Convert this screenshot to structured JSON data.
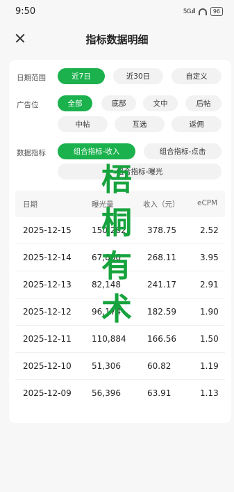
{
  "status_bar": {
    "time": "9:50",
    "signal": "5G.ıll",
    "battery": "96"
  },
  "header": {
    "title": "指标数据明细"
  },
  "filters": {
    "date": {
      "label": "日期范围",
      "options": [
        "近7日",
        "近30日",
        "自定义"
      ],
      "selected": "近7日"
    },
    "ad_slot": {
      "label": "广告位",
      "options": [
        "全部",
        "底部",
        "文中",
        "后帖",
        "中帖",
        "互选",
        "返佣"
      ],
      "selected": "全部"
    },
    "metric": {
      "label": "数据指标",
      "options": [
        "组合指标-收入",
        "组合指标-点击",
        "组合指标-曝光"
      ],
      "selected": "组合指标-收入"
    }
  },
  "table": {
    "headers": [
      "日期",
      "曝光量",
      "收入（元）",
      "eCPM"
    ],
    "rows": [
      [
        "2025-12-15",
        "150,262",
        "378.75",
        "2.52"
      ],
      [
        "2025-12-14",
        "67,806",
        "268.11",
        "3.95"
      ],
      [
        "2025-12-13",
        "82,148",
        "241.17",
        "2.91"
      ],
      [
        "2025-12-12",
        "96,174",
        "182.59",
        "1.90"
      ],
      [
        "2025-12-11",
        "110,884",
        "166.56",
        "1.50"
      ],
      [
        "2025-12-10",
        "51,306",
        "60.82",
        "1.19"
      ],
      [
        "2025-12-09",
        "56,396",
        "63.91",
        "1.13"
      ]
    ]
  },
  "watermark": {
    "chars": [
      "梧",
      "桐",
      "有",
      "术"
    ],
    "color": "#16a33d"
  },
  "colors": {
    "accent": "#1bb14d",
    "chip_bg": "#f1f2f1",
    "page_bg": "#f6f7f6"
  }
}
